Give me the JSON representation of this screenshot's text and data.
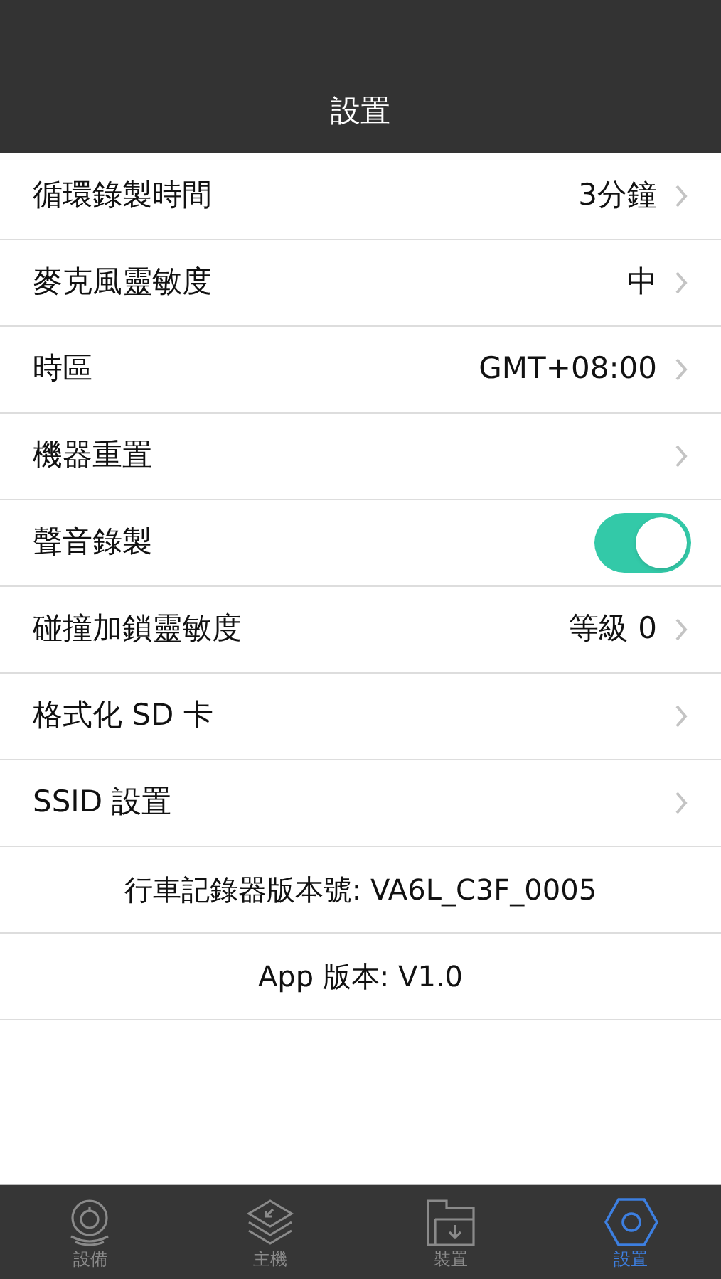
{
  "header": {
    "title": "設置"
  },
  "rows": [
    {
      "kind": "link",
      "label": "循環錄製時間",
      "value": "3分鐘"
    },
    {
      "kind": "link",
      "label": "麥克風靈敏度",
      "value": "中"
    },
    {
      "kind": "link",
      "label": "時區",
      "value": "GMT+08:00"
    },
    {
      "kind": "link",
      "label": "機器重置"
    },
    {
      "kind": "toggle",
      "label": "聲音錄製",
      "on": true
    },
    {
      "kind": "link",
      "label": "碰撞加鎖靈敏度",
      "value": "等級 0"
    },
    {
      "kind": "link",
      "label": "格式化 SD 卡"
    },
    {
      "kind": "link",
      "label": "SSID 設置"
    },
    {
      "kind": "info",
      "label": "行車記錄器版本號: VA6L_C3F_0005"
    },
    {
      "kind": "info",
      "label": "App 版本: V1.0"
    }
  ],
  "tabs": [
    {
      "label": "設備",
      "selected": false
    },
    {
      "label": "主機",
      "selected": false
    },
    {
      "label": "裝置",
      "selected": false
    },
    {
      "label": "設置",
      "selected": true
    }
  ]
}
